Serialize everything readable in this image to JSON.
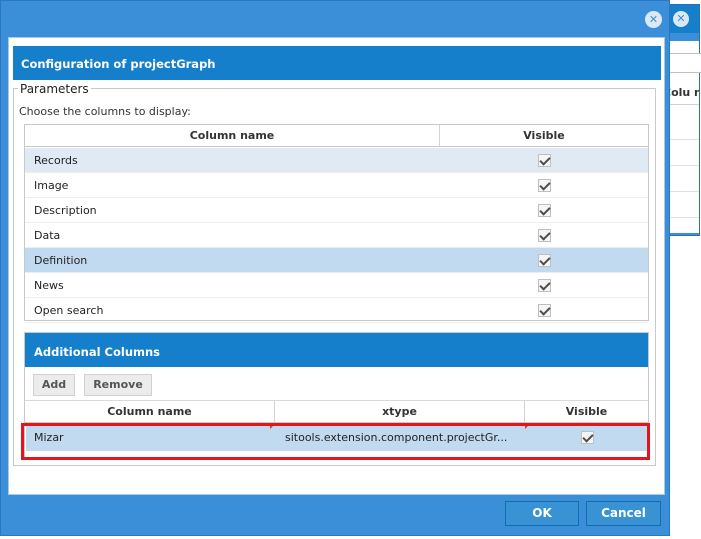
{
  "dialog": {
    "title": "Configuration of projectGraph",
    "close_glyph": "✕"
  },
  "background_window": {
    "close_glyph": "✕",
    "column_header_fragment": "Colu name"
  },
  "parameters": {
    "legend": "Parameters",
    "hint": "Choose the columns to display:",
    "columns": {
      "name": "Column name",
      "visible": "Visible"
    },
    "rows": [
      {
        "name": "Records",
        "visible": true
      },
      {
        "name": "Image",
        "visible": true
      },
      {
        "name": "Description",
        "visible": true
      },
      {
        "name": "Data",
        "visible": true
      },
      {
        "name": "Definition",
        "visible": true
      },
      {
        "name": "News",
        "visible": true
      },
      {
        "name": "Open search",
        "visible": true
      }
    ]
  },
  "additional": {
    "title": "Additional Columns",
    "add_label": "Add",
    "remove_label": "Remove",
    "columns": {
      "name": "Column name",
      "xtype": "xtype",
      "visible": "Visible"
    },
    "rows": [
      {
        "name": "Mizar",
        "xtype": "sitools.extension.component.projectGr...",
        "visible": true
      }
    ]
  },
  "footer": {
    "ok_label": "OK",
    "cancel_label": "Cancel"
  },
  "colors": {
    "window_blue": "#3b8fd9",
    "header_blue": "#157fcc",
    "selected_row": "#c2daf0",
    "alt_row": "#dfeaf5",
    "highlight_red": "#e2161e"
  }
}
